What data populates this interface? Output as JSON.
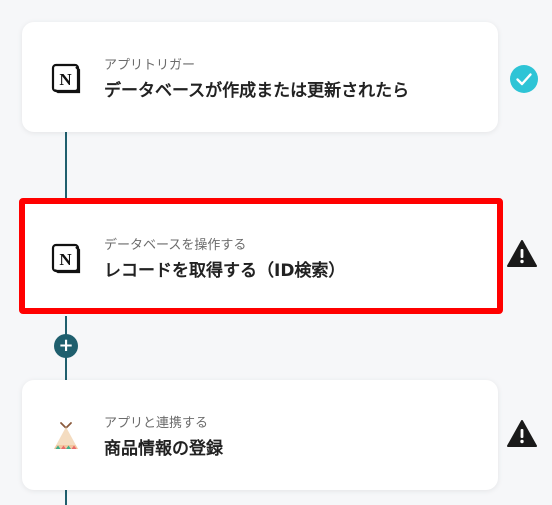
{
  "flow": {
    "steps": [
      {
        "subtitle": "アプリトリガー",
        "title": "データベースが作成または更新されたら",
        "app_icon": "notion-icon",
        "status": "check-circle-icon"
      },
      {
        "subtitle": "データベースを操作する",
        "title": "レコードを取得する（ID検索）",
        "app_icon": "notion-icon",
        "status": "warning-icon",
        "highlighted": true
      },
      {
        "subtitle": "アプリと連携する",
        "title": "商品情報の登録",
        "app_icon": "teepee-icon",
        "status": "warning-icon"
      }
    ],
    "add_button": "+"
  },
  "colors": {
    "connector": "#1f5f6e",
    "highlight": "#ff0000",
    "check": "#2ec4d6",
    "warning": "#1a1a1a"
  }
}
